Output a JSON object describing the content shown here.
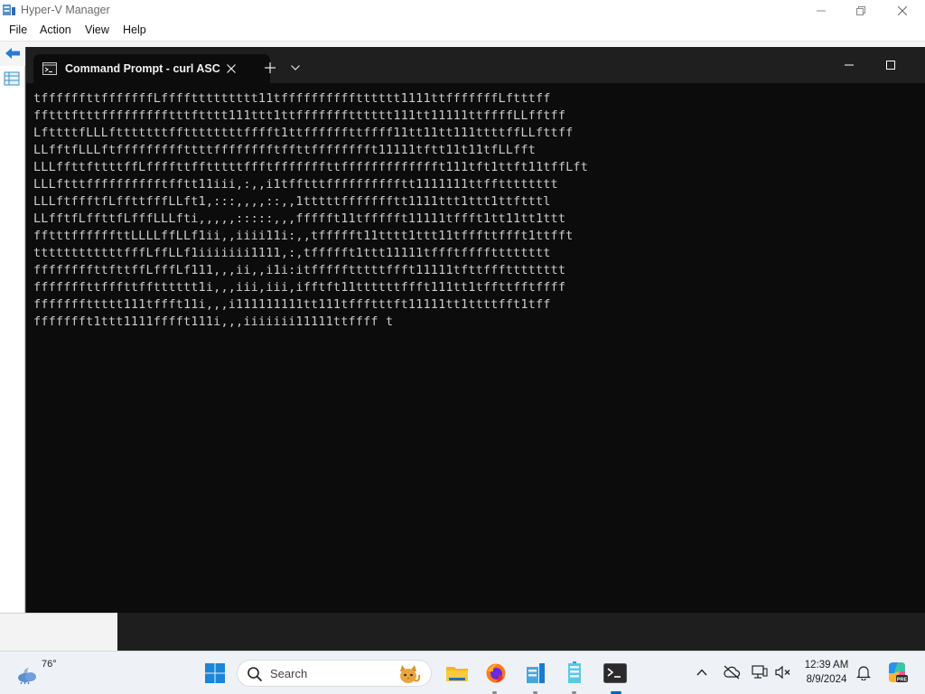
{
  "hyperv": {
    "title": "Hyper-V Manager",
    "menu": [
      "File",
      "Action",
      "View",
      "Help"
    ]
  },
  "terminal": {
    "tab_title": "Command Prompt - curl  ASC",
    "lines": [
      "tffffffttfffffffLffffttttttttt11tfffffffffftttttt1111ttfffffffLftttff",
      "fftttftttffffffffftttftttt111ttt1ttffffffftttttt111tt11111ttffffLLfftff",
      "LfttttfLLLftttttttffttttttttfffft1ttffffffttffff11tt11tt111ttttffLLfttff",
      "LLfftfLLLftfffffffffttttfffffffftffttfffffffft11111tftt11t11tfLLfft",
      "LLLffttfttttffLffffttfftttttffftfffffffttffffffffffffft111tft1ttft11tffLft",
      "LLLftttfffffffffftfftt11iii,:,,i1tfftttfffffffffftt1111111ttfftttttttt",
      "LLLftffftfLffttfffLLft1,:::,,,,::,,1tttttffffffftt1111ttt1ttt1ttftttl",
      "LLfftfLffttfLfffLLLfti,,,,,:::::,,,ffffft11tffffft11111tffft1tt11tt1ttt",
      "fftttffffffttLLLLffLLf1ii,,iiii11i:,,tffffft11tttt1ttt11tfffttffft1ttfft",
      "ttttttttttttfffLffLLf1iiiiiii1111,:,tffffft1ttt11111tffftfffftttttttt",
      "ffffffffttfttffLfffLf111,,,ii,,i1i:itffffftttttffft11111tfttffftttttttt",
      "fffffffttfffttfftttttt1i,,,iii,iii,ifftft11ttttttffft111tt1tffttfftffff",
      "fffffffttttt111tffft11i,,,i111111111tt111tffftttft11111tt1ttttfft1tff",
      "ffffffft1ttt1111fffft111i,,,iiiiiii11111ttffff t"
    ]
  },
  "taskbar": {
    "weather_temp": "76°",
    "search_label": "Search",
    "time": "12:39 AM",
    "date": "8/9/2024"
  }
}
